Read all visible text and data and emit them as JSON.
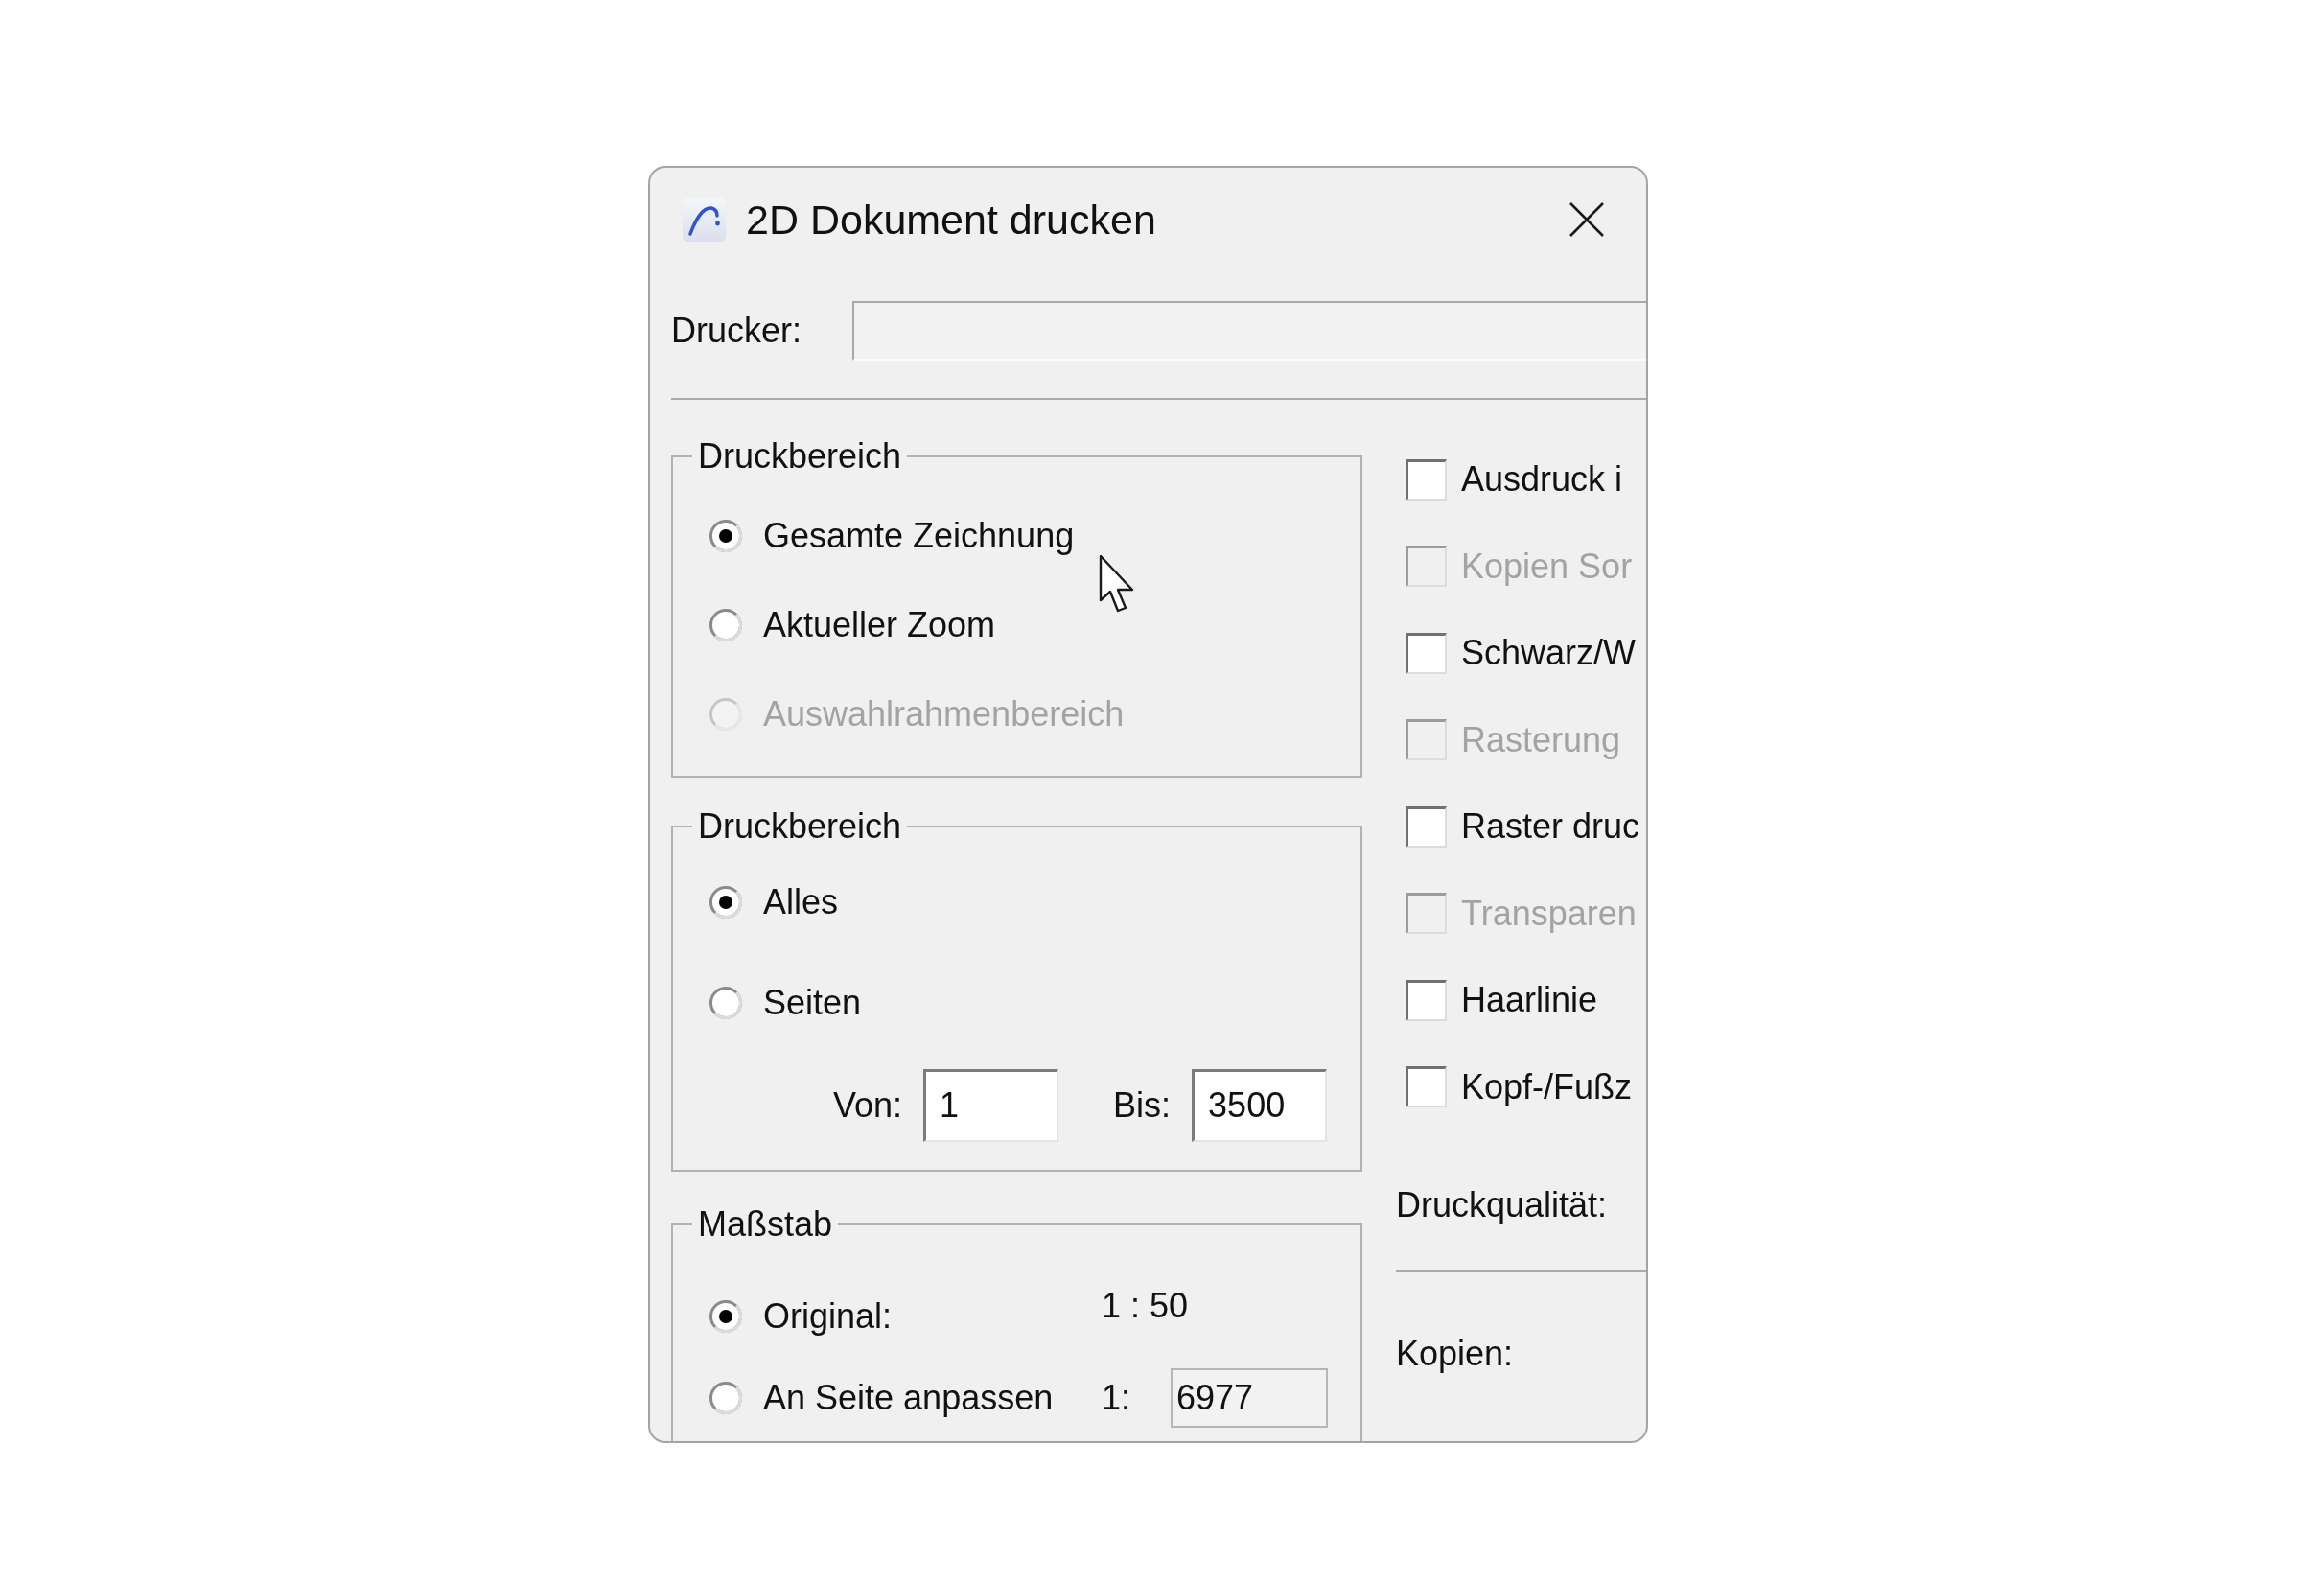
{
  "window": {
    "title": "2D Dokument drucken"
  },
  "printer": {
    "label": "Drucker:"
  },
  "drawing_area": {
    "title": "Druckbereich",
    "options": [
      {
        "label": "Gesamte Zeichnung",
        "selected": true,
        "disabled": false
      },
      {
        "label": "Aktueller Zoom",
        "selected": false,
        "disabled": false
      },
      {
        "label": "Auswahlrahmenbereich",
        "selected": false,
        "disabled": true
      }
    ]
  },
  "page_range": {
    "title": "Druckbereich",
    "options": [
      {
        "label": "Alles",
        "selected": true,
        "disabled": false
      },
      {
        "label": "Seiten",
        "selected": false,
        "disabled": false
      }
    ],
    "from": {
      "label": "Von:",
      "value": "1"
    },
    "to": {
      "label": "Bis:",
      "value": "3500"
    }
  },
  "scale": {
    "title": "Maßstab",
    "options": [
      {
        "kind": "readout",
        "label": "Original:",
        "selected": true,
        "disabled": false,
        "value": "1 : 50"
      },
      {
        "kind": "input",
        "label": "An Seite anpassen",
        "selected": false,
        "disabled": false,
        "prefix": "1:",
        "value": "6977"
      }
    ]
  },
  "checks": [
    {
      "label": "Ausdruck i",
      "checked": false,
      "disabled": false
    },
    {
      "label": "Kopien Sor",
      "checked": false,
      "disabled": true
    },
    {
      "label": "Schwarz/W",
      "checked": false,
      "disabled": false
    },
    {
      "label": "Rasterung",
      "checked": false,
      "disabled": true
    },
    {
      "label": "Raster druc",
      "checked": false,
      "disabled": false
    },
    {
      "label": "Transparen",
      "checked": false,
      "disabled": true
    },
    {
      "label": "Haarlinie",
      "checked": false,
      "disabled": false
    },
    {
      "label": "Kopf-/Fußz",
      "checked": false,
      "disabled": false
    }
  ],
  "quality": {
    "label": "Druckqualität:"
  },
  "copies": {
    "label": "Kopien:"
  }
}
